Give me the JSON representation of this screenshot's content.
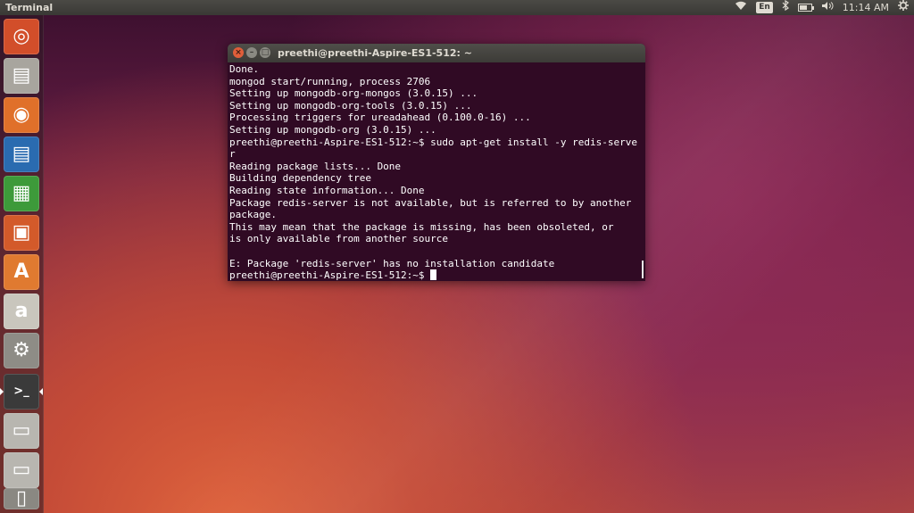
{
  "topbar": {
    "app_title": "Terminal",
    "lang": "En",
    "clock": "11:14 AM",
    "icons": [
      "wifi-icon",
      "bluetooth-icon",
      "battery-icon",
      "volume-icon",
      "gear-icon"
    ],
    "battery_level": 0.7
  },
  "launcher": {
    "items": [
      {
        "name": "ubuntu-dash-icon",
        "sym": "◎",
        "color": "#d24e2a"
      },
      {
        "name": "files-icon",
        "sym": "▤",
        "color": "#a8a59e"
      },
      {
        "name": "firefox-icon",
        "sym": "◉",
        "color": "#e0702a"
      },
      {
        "name": "libreoffice-writer-icon",
        "sym": "▤",
        "color": "#2a6bb0"
      },
      {
        "name": "libreoffice-calc-icon",
        "sym": "▦",
        "color": "#3d9a3a"
      },
      {
        "name": "libreoffice-impress-icon",
        "sym": "▣",
        "color": "#d35a2a"
      },
      {
        "name": "software-center-icon",
        "sym": "A",
        "color": "#e07a30"
      },
      {
        "name": "amazon-icon",
        "sym": "a",
        "color": "#c9c6bd"
      },
      {
        "name": "system-settings-icon",
        "sym": "⚙",
        "color": "#8e8c86"
      },
      {
        "name": "terminal-icon",
        "sym": ">_",
        "color": "#3a3a3a"
      },
      {
        "name": "drive-icon",
        "sym": "▭",
        "color": "#b8b6b0"
      },
      {
        "name": "drive-icon-2",
        "sym": "▭",
        "color": "#b8b6b0"
      },
      {
        "name": "trash-icon",
        "sym": "▯",
        "color": "#8a8882"
      }
    ]
  },
  "terminal": {
    "title": "preethi@preethi-Aspire-ES1-512: ~",
    "lines": [
      "Done.",
      "mongod start/running, process 2706",
      "Setting up mongodb-org-mongos (3.0.15) ...",
      "Setting up mongodb-org-tools (3.0.15) ...",
      "Processing triggers for ureadahead (0.100.0-16) ...",
      "Setting up mongodb-org (3.0.15) ...",
      "preethi@preethi-Aspire-ES1-512:~$ sudo apt-get install -y redis-serve",
      "r",
      "Reading package lists... Done",
      "Building dependency tree",
      "Reading state information... Done",
      "Package redis-server is not available, but is referred to by another",
      "package.",
      "This may mean that the package is missing, has been obsoleted, or",
      "is only available from another source",
      "",
      "E: Package 'redis-server' has no installation candidate"
    ],
    "prompt": "preethi@preethi-Aspire-ES1-512:~$ "
  }
}
